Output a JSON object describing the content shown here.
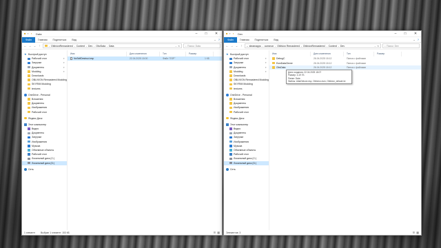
{
  "left_window": {
    "title": "Data",
    "ribbon_tabs": [
      "Файл",
      "Главная",
      "Поделиться",
      "Вид"
    ],
    "breadcrumb": [
      "OblivionRemastered",
      "Content",
      "Dev",
      "ObvData",
      "Data"
    ],
    "search_placeholder": "Поиск: Data",
    "columns": [
      "Имя",
      "Дата изменения",
      "Тип",
      "Размер"
    ],
    "files": [
      {
        "name": "NoSelfDestruct.esp",
        "date": "22.04.2025 18:00",
        "type": "Файл \"ESP\"",
        "size": "1 КБ"
      }
    ],
    "nav": {
      "quick_access_label": "Быстрый доступ",
      "quick_items": [
        {
          "label": "Рабочий стол",
          "pinned": true
        },
        {
          "label": "Загрузки",
          "pinned": true
        },
        {
          "label": "Документы",
          "pinned": true
        },
        {
          "label": "Modding",
          "pinned": true
        },
        {
          "label": "Downloads",
          "pinned": false
        },
        {
          "label": "OBLIVION Remastered Modding",
          "pinned": false
        },
        {
          "label": "SKYRIM Modding",
          "pinned": false
        },
        {
          "label": "textures",
          "pinned": false
        }
      ],
      "onedrive_label": "OneDrive - Personal",
      "onedrive_items": [
        "Вложения",
        "Документы",
        "Изображения",
        "Рабочий стол"
      ],
      "yandex_label": "Яндекс Диск",
      "pc_label": "Этот компьютер",
      "pc_items": [
        "Видео",
        "Документы",
        "Загрузки",
        "Изображения",
        "Музыка",
        "Объемные объекты",
        "Рабочий стол",
        "Локальный диск (C:)",
        "Локальный диск (D:)"
      ],
      "network_label": "Сеть"
    },
    "status": {
      "count": "1 элемент",
      "selected": "Выбран 1 элемент: 153 КБ"
    }
  },
  "right_window": {
    "title": "Dev",
    "ribbon_tabs": [
      "Файл",
      "Главная",
      "Поделиться",
      "Вид"
    ],
    "breadcrumb": [
      "steamapps",
      "common",
      "Oblivion Remastered",
      "OblivionRemastered",
      "Content",
      "Dev"
    ],
    "search_placeholder": "Поиск: Dev",
    "columns": [
      "Имя",
      "Дата изменения",
      "Тип",
      "Размер"
    ],
    "files": [
      {
        "name": "DebugС",
        "date": "26.04.2025 18:12",
        "type": "Папка с файлами",
        "size": ""
      },
      {
        "name": "EsmDataСlever",
        "date": "26.04.2025 18:12",
        "type": "Папка с файлами",
        "size": ""
      },
      {
        "name": "ObvData",
        "date": "26.04.2025 18:12",
        "type": "Папка с файлами",
        "size": ""
      }
    ],
    "tooltip": {
      "line1": "Дата создания: 22.04.2025 18:07",
      "line2": "Размер: 4,19 ГБ",
      "line3": "Папки: Data",
      "line4": "Файлы: AltarDeluxe.esp, Oblivion.esm, Oblivion_default.ini"
    },
    "nav": {
      "quick_access_label": "Быстрый доступ",
      "quick_items": [
        {
          "label": "Рабочий стол",
          "pinned": true
        },
        {
          "label": "Загрузки",
          "pinned": true
        },
        {
          "label": "Документы",
          "pinned": true
        },
        {
          "label": "Modding",
          "pinned": true
        },
        {
          "label": "Downloads",
          "pinned": false
        },
        {
          "label": "OBLIVION Remastered Modding",
          "pinned": false
        },
        {
          "label": "SKYRIM Modding",
          "pinned": false
        },
        {
          "label": "textures",
          "pinned": false
        }
      ],
      "onedrive_label": "OneDrive - Personal",
      "onedrive_items": [
        "Вложения",
        "Документы",
        "Изображения",
        "Рабочий стол"
      ],
      "yandex_label": "Яндекс Диск",
      "pc_label": "Этот компьютер",
      "pc_items": [
        "Видео",
        "Документы",
        "Загрузки",
        "Изображения",
        "Музыка",
        "Объемные объекты",
        "Рабочий стол",
        "Локальный диск (C:)",
        "Локальный диск (D:)"
      ],
      "network_label": "Сеть"
    },
    "status": {
      "count": "Элементов: 3",
      "selected": ""
    }
  },
  "colors": {
    "accent": "#1979ca",
    "folder": "#f3c443",
    "selection": "#cce8ff"
  }
}
